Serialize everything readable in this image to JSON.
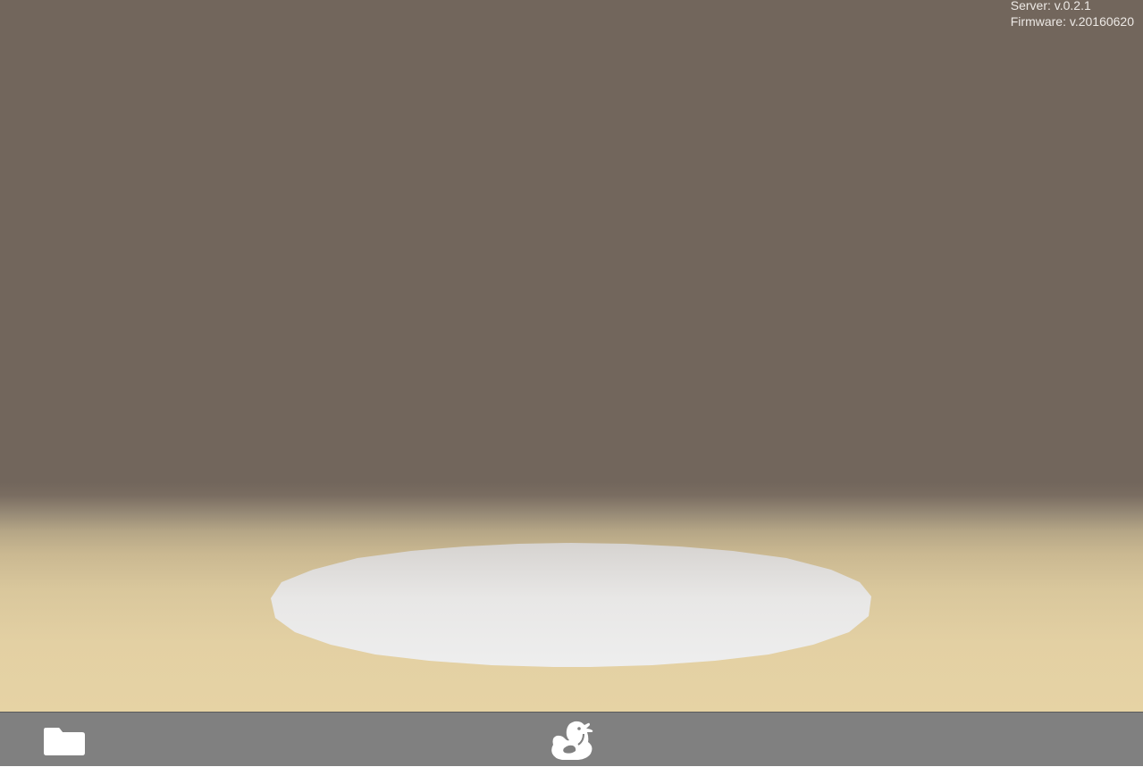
{
  "viewport": {
    "server_version": "Server: v.0.2.1",
    "firmware_version": "Firmware: v.20160620"
  },
  "toolbar": {
    "left_icon": "folder-icon",
    "center_icon": "duck-icon"
  },
  "colors": {
    "background_top": "#72665c",
    "floor": "#e6d3a4",
    "build_plate": "#ececec",
    "toolbar": "#808080",
    "icon": "#ffffff"
  }
}
